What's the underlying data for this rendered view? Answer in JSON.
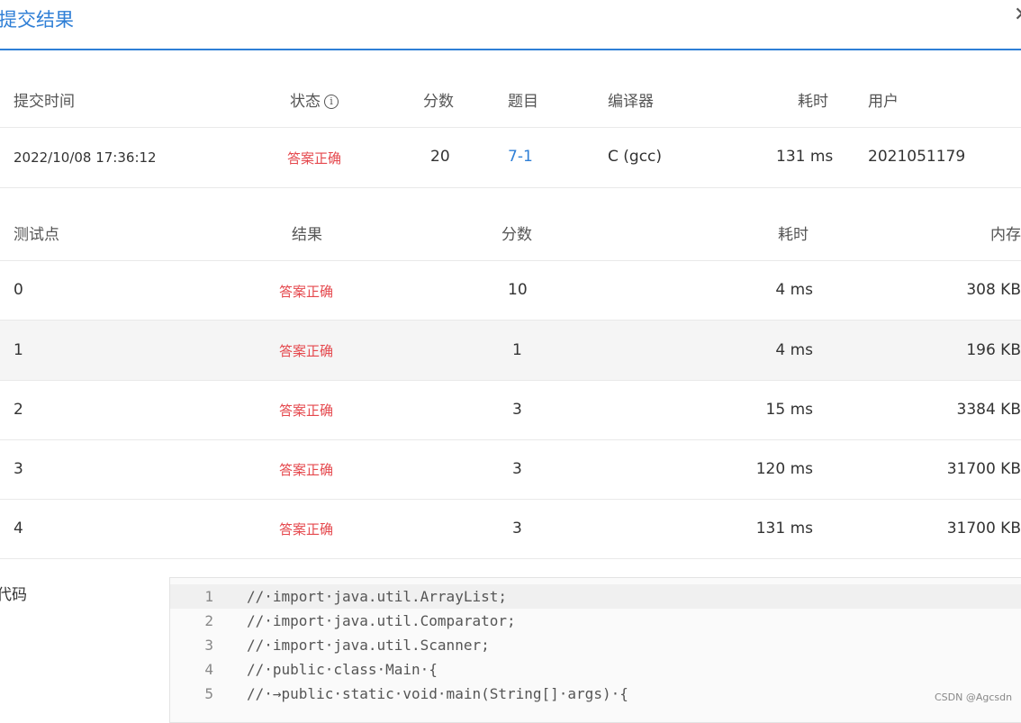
{
  "dialog": {
    "title": "提交结果",
    "close_icon": "close-icon"
  },
  "summary": {
    "headers": {
      "time": "提交时间",
      "status": "状态",
      "score": "分数",
      "problem": "题目",
      "compiler": "编译器",
      "duration": "耗时",
      "user": "用户"
    },
    "status_info_icon": "info-icon",
    "row": {
      "time": "2022/10/08 17:36:12",
      "status": "答案正确",
      "score": "20",
      "problem": "7-1",
      "compiler": "C (gcc)",
      "duration": "131 ms",
      "user": "2021051179"
    }
  },
  "tests": {
    "headers": {
      "case": "测试点",
      "result": "结果",
      "score": "分数",
      "duration": "耗时",
      "memory": "内存"
    },
    "rows": [
      {
        "case": "0",
        "result": "答案正确",
        "score": "10",
        "duration": "4 ms",
        "memory": "308 KB"
      },
      {
        "case": "1",
        "result": "答案正确",
        "score": "1",
        "duration": "4 ms",
        "memory": "196 KB"
      },
      {
        "case": "2",
        "result": "答案正确",
        "score": "3",
        "duration": "15 ms",
        "memory": "3384 KB"
      },
      {
        "case": "3",
        "result": "答案正确",
        "score": "3",
        "duration": "120 ms",
        "memory": "31700 KB"
      },
      {
        "case": "4",
        "result": "答案正确",
        "score": "3",
        "duration": "131 ms",
        "memory": "31700 KB"
      }
    ]
  },
  "code": {
    "label": "代码",
    "lines": [
      {
        "num": "1",
        "text": "//·import·java.util.ArrayList;"
      },
      {
        "num": "2",
        "text": "//·import·java.util.Comparator;"
      },
      {
        "num": "3",
        "text": "//·import·java.util.Scanner;"
      },
      {
        "num": "4",
        "text": "//·public·class·Main·{"
      },
      {
        "num": "5",
        "text": "//·→public·static·void·main(String[]·args)·{"
      }
    ]
  },
  "watermark": "CSDN @Agcsdn",
  "colors": {
    "accent": "#2f7fd6",
    "success_text": "#e5484d",
    "row_hover": "#f5f5f5"
  }
}
